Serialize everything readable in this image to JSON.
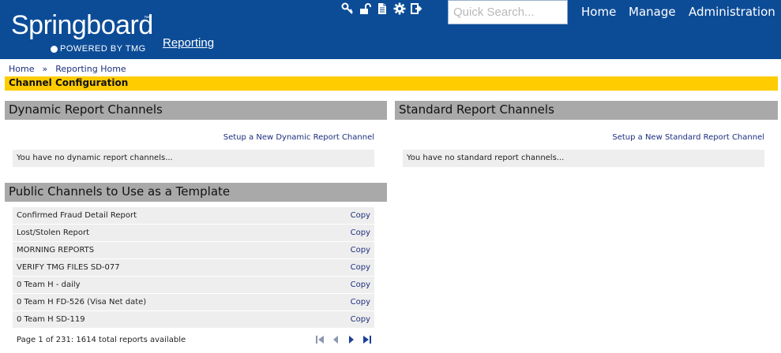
{
  "brand": {
    "name": "Springboard",
    "trademark": "™",
    "tagline": "POWERED BY TMG"
  },
  "header": {
    "reporting_link": "Reporting",
    "search_placeholder": "Quick Search...",
    "nav": [
      "Home",
      "Manage",
      "Administration"
    ],
    "toolbar_icons": [
      "key-icon",
      "unlock-icon",
      "document-icon",
      "gear-icon",
      "logout-icon"
    ]
  },
  "breadcrumb": {
    "items": [
      "Home",
      "Reporting Home"
    ],
    "separator": "»"
  },
  "page_title": "Channel Configuration",
  "dynamic": {
    "heading": "Dynamic Report Channels",
    "setup_link": "Setup a New Dynamic Report Channel",
    "empty_message": "You have no dynamic report channels..."
  },
  "standard": {
    "heading": "Standard Report Channels",
    "setup_link": "Setup a New Standard Report Channel",
    "empty_message": "You have no standard report channels..."
  },
  "templates": {
    "heading": "Public Channels to Use as a Template",
    "copy_label": "Copy",
    "rows": [
      "Confirmed Fraud Detail Report",
      "Lost/Stolen Report",
      "MORNING REPORTS",
      "VERIFY TMG FILES SD-077",
      "0 Team H - daily",
      "0 Team H FD-526 (Visa Net date)",
      "0 Team H SD-119"
    ],
    "pager_text": "Page 1 of 231: 1614 total reports available",
    "pager_icons": [
      "first-page-icon",
      "prev-page-icon",
      "next-page-icon",
      "last-page-icon"
    ]
  },
  "colors": {
    "header_bg": "#0c4c97",
    "title_bar": "#ffcc00",
    "section_head": "#a9a9a9",
    "row_bg": "#eeeeee",
    "link": "#1c2f7e"
  }
}
